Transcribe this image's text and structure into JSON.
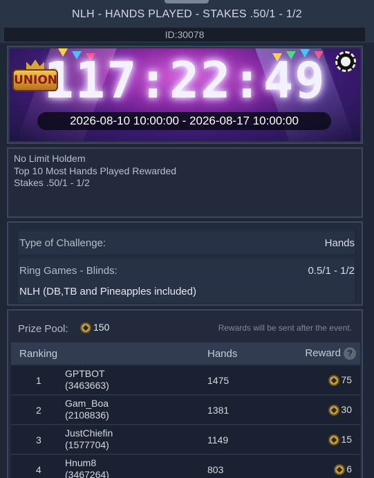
{
  "header": {
    "title": "NLH - HANDS PLAYED - STAKES .50/1 - 1/2",
    "id_label": "ID:30078"
  },
  "banner": {
    "logo_text": "UNION",
    "countdown": "117:22:49",
    "date_range": "2026-08-10 10:00:00 - 2026-08-17 10:00:00"
  },
  "description": {
    "lines": [
      "No Limit Holdem",
      "Top 10 Most Hands Played Rewarded",
      "Stakes .50/1 - 1/2"
    ]
  },
  "challenge": {
    "type_label": "Type of Challenge:",
    "type_value": "Hands",
    "blinds_label": "Ring Games - Blinds:",
    "blinds_value": "0.5/1 - 1/2",
    "game_note": "NLH (DB,TB and Pineapples included)"
  },
  "prize": {
    "label": "Prize Pool:",
    "pool_value": "150",
    "note": "Rewards will be sent after the event.",
    "columns": {
      "ranking": "Ranking",
      "hands": "Hands",
      "reward": "Reward",
      "help": "?"
    },
    "rows": [
      {
        "rank": "1",
        "name": "GPTBOT",
        "pid": "(3463663)",
        "hands": "1475",
        "reward": "75"
      },
      {
        "rank": "2",
        "name": "Gam_Boa",
        "pid": "(2108836)",
        "hands": "1381",
        "reward": "30"
      },
      {
        "rank": "3",
        "name": "JustChiefin",
        "pid": "(1577704)",
        "hands": "1149",
        "reward": "15"
      },
      {
        "rank": "4",
        "name": "Hnum8",
        "pid": "(3467264)",
        "hands": "803",
        "reward": "6"
      }
    ]
  },
  "icons": {
    "coin": "coin-icon",
    "chip": "poker-chip-icon",
    "help": "help-icon"
  },
  "colors": {
    "background": "#1f2737",
    "panel_border": "#3c475d",
    "coin": "#c8a13e"
  }
}
